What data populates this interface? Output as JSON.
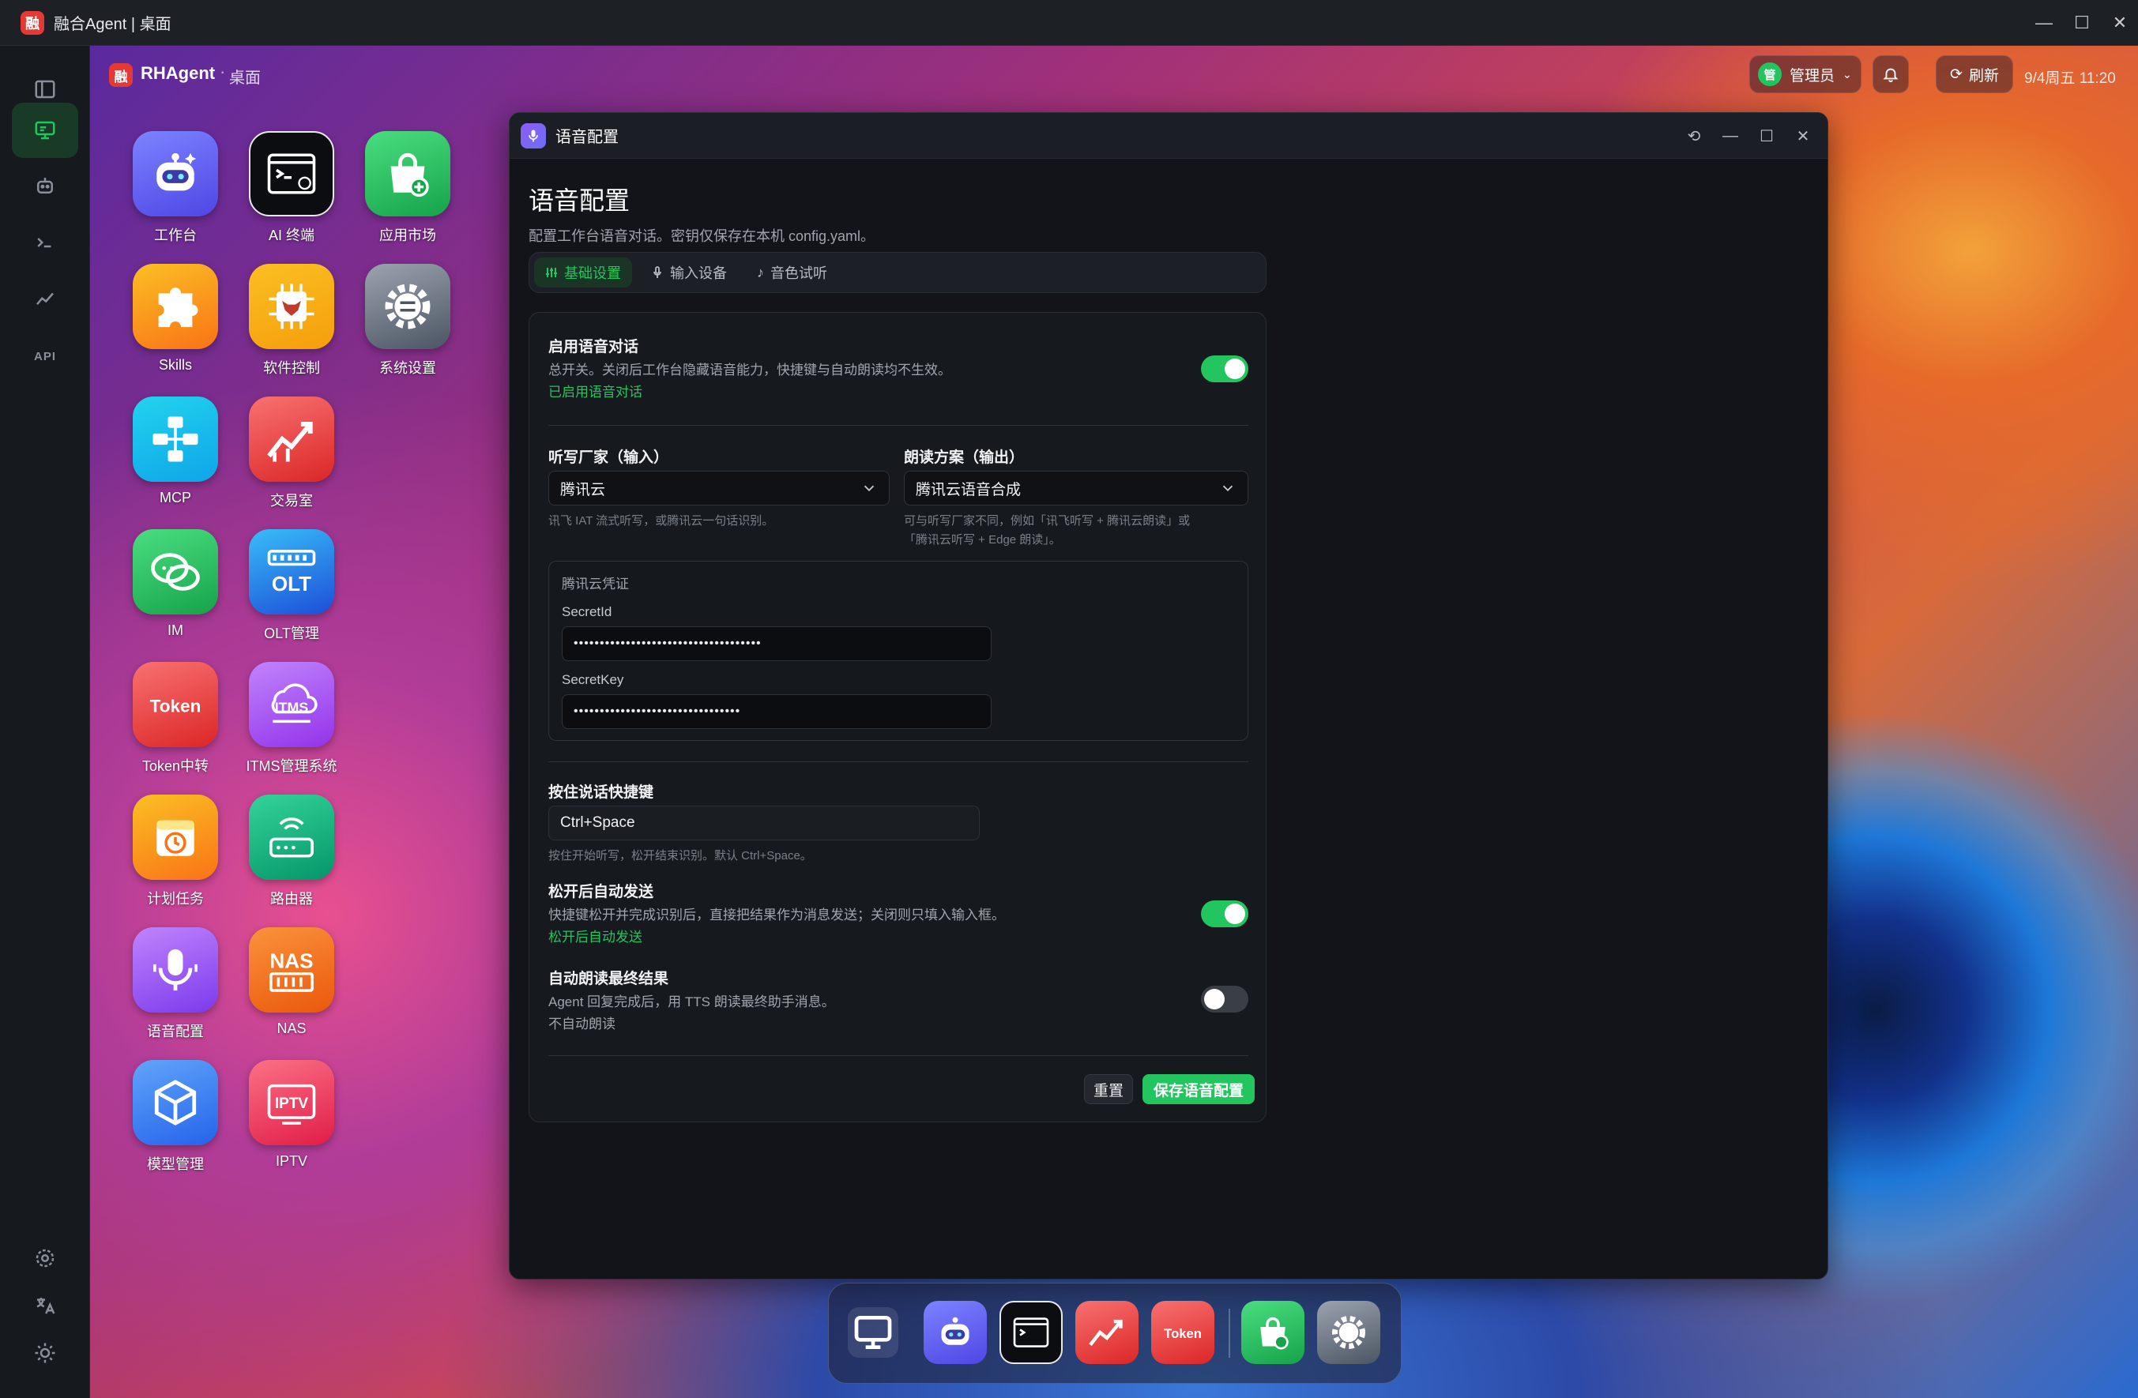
{
  "window": {
    "title": "融合Agent | 桌面",
    "logo_text": "融"
  },
  "topbar": {
    "brand": "RHAgent",
    "crumb": "桌面",
    "user_role": "管理员",
    "user_avatar_text": "管",
    "refresh_label": "刷新",
    "datetime": "9/4周五 11:20"
  },
  "left_rail": {
    "api_label": "API"
  },
  "desktop_apps": [
    {
      "label": "工作台"
    },
    {
      "label": "AI 终端"
    },
    {
      "label": "应用市场"
    },
    {
      "label": "Skills"
    },
    {
      "label": "软件控制"
    },
    {
      "label": "系统设置"
    },
    {
      "label": "MCP"
    },
    {
      "label": "交易室"
    },
    {
      "label": "IM"
    },
    {
      "label": "OLT管理",
      "glyph": "OLT"
    },
    {
      "label": "Token中转",
      "glyph": "Token"
    },
    {
      "label": "ITMS管理系统",
      "glyph": "ITMS"
    },
    {
      "label": "计划任务"
    },
    {
      "label": "路由器"
    },
    {
      "label": "语音配置"
    },
    {
      "label": "NAS",
      "glyph": "NAS"
    },
    {
      "label": "模型管理"
    },
    {
      "label": "IPTV",
      "glyph": "IPTV"
    }
  ],
  "voice_window": {
    "title": "语音配置",
    "heading": "语音配置",
    "subtitle": "配置工作台语音对话。密钥仅保存在本机 config.yaml。",
    "tabs": [
      {
        "label": "基础设置",
        "icon": "sliders-icon",
        "active": true
      },
      {
        "label": "输入设备",
        "icon": "mic-icon",
        "active": false
      },
      {
        "label": "音色试听",
        "icon": "music-note-icon",
        "active": false
      }
    ],
    "enable_voice": {
      "title": "启用语音对话",
      "desc": "总开关。关闭后工作台隐藏语音能力，快捷键与自动朗读均不生效。",
      "status": "已启用语音对话",
      "on": true
    },
    "stt": {
      "label": "听写厂家（输入）",
      "value": "腾讯云",
      "hint": "讯飞 IAT 流式听写，或腾讯云一句话识别。"
    },
    "tts": {
      "label": "朗读方案（输出）",
      "value": "腾讯云语音合成",
      "hint_line1": "可与听写厂家不同，例如「讯飞听写 + 腾讯云朗读」或",
      "hint_line2": "「腾讯云听写 + Edge 朗读」。"
    },
    "credentials": {
      "title": "腾讯云凭证",
      "secret_id_label": "SecretId",
      "secret_id_value": "••••••••••••••••••••••••••••••••••••",
      "secret_key_label": "SecretKey",
      "secret_key_value": "••••••••••••••••••••••••••••••••"
    },
    "hotkey": {
      "label": "按住说话快捷键",
      "value": "Ctrl+Space",
      "hint": "按住开始听写，松开结束识别。默认 Ctrl+Space。"
    },
    "auto_send": {
      "title": "松开后自动发送",
      "desc": "快捷键松开并完成识别后，直接把结果作为消息发送；关闭则只填入输入框。",
      "status": "松开后自动发送",
      "on": true
    },
    "auto_read": {
      "title": "自动朗读最终结果",
      "desc": "Agent 回复完成后，用 TTS 朗读最终助手消息。",
      "status": "不自动朗读",
      "on": false
    },
    "buttons": {
      "reset": "重置",
      "save": "保存语音配置"
    }
  },
  "dock": {
    "items": [
      {
        "name": "desktop"
      },
      {
        "name": "工作台"
      },
      {
        "name": "AI 终端"
      },
      {
        "name": "交易室"
      },
      {
        "name": "Token中转",
        "glyph": "Token"
      },
      {
        "name": "应用市场"
      },
      {
        "name": "系统设置"
      }
    ]
  },
  "colors": {
    "accent": "#22c55e",
    "window_bg": "#121419",
    "danger": "#e53935"
  }
}
